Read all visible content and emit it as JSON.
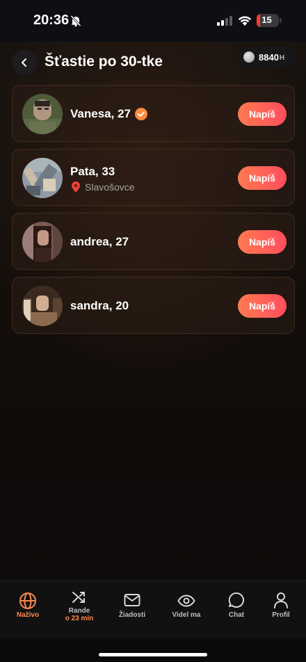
{
  "status_bar": {
    "time": "20:36",
    "battery": "15",
    "battery_level_percent": 15
  },
  "header": {
    "title": "Šťastie po 30-tke",
    "coins": "8840",
    "coin_unit": "H"
  },
  "profiles": [
    {
      "name": "Vanesa, 27",
      "verified": true,
      "location": "",
      "action": "Napíš"
    },
    {
      "name": "Pata, 33",
      "verified": false,
      "location": "Slavošovce",
      "action": "Napíš"
    },
    {
      "name": "andrea, 27",
      "verified": false,
      "location": "",
      "action": "Napíš"
    },
    {
      "name": "sandra, 20",
      "verified": false,
      "location": "",
      "action": "Napíš"
    }
  ],
  "bottom_nav": {
    "live": "Naživo",
    "date": "Rande",
    "date_timer": "o 23 min",
    "requests": "Žiadosti",
    "viewed": "Videl ma",
    "chat": "Chat",
    "profile": "Profil"
  },
  "colors": {
    "accent": "#ff8a4c",
    "button_start": "#ff7a50",
    "button_end": "#ff4e5e",
    "verified": "#ff8a3d"
  }
}
